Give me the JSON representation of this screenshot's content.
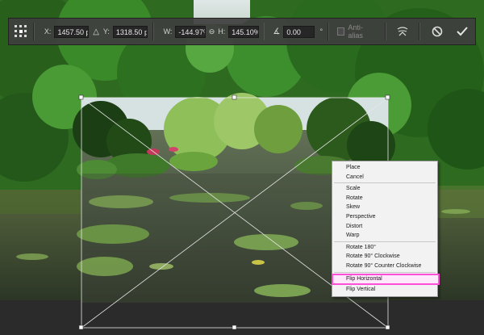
{
  "toolbar": {
    "reference_point_icon": "reference-point-grid-icon",
    "x_label": "X:",
    "x_value": "1457.50 px",
    "delta_icon": "relative-position-icon",
    "y_label": "Y:",
    "y_value": "1318.50 px",
    "w_label": "W:",
    "w_value": "-144.97%",
    "link_icon": "link-icon",
    "h_label": "H:",
    "h_value": "145.10%",
    "angle_icon": "angle-icon",
    "angle_value": "0.00",
    "angle_unit": "°",
    "antialias_label": "Anti-alias",
    "warp_icon": "warp-mode-icon",
    "cancel_icon": "cancel-transform-icon",
    "commit_icon": "commit-transform-icon"
  },
  "context_menu": {
    "groups": [
      [
        "Place",
        "Cancel"
      ],
      [
        "Scale",
        "Rotate",
        "Skew",
        "Perspective",
        "Distort",
        "Warp"
      ],
      [
        "Rotate 180°",
        "Rotate 90° Clockwise",
        "Rotate 90° Counter Clockwise"
      ],
      [
        "Flip Horizontal",
        "Flip Vertical"
      ]
    ],
    "highlighted": "Flip Horizontal",
    "highlight_color": "#ff4fd8"
  },
  "colors": {
    "toolbar_bg": "#3e3e3e",
    "canvas_dark": "#2b2b2b",
    "foliage": "#2f7a24",
    "water": "#3d4a38"
  }
}
